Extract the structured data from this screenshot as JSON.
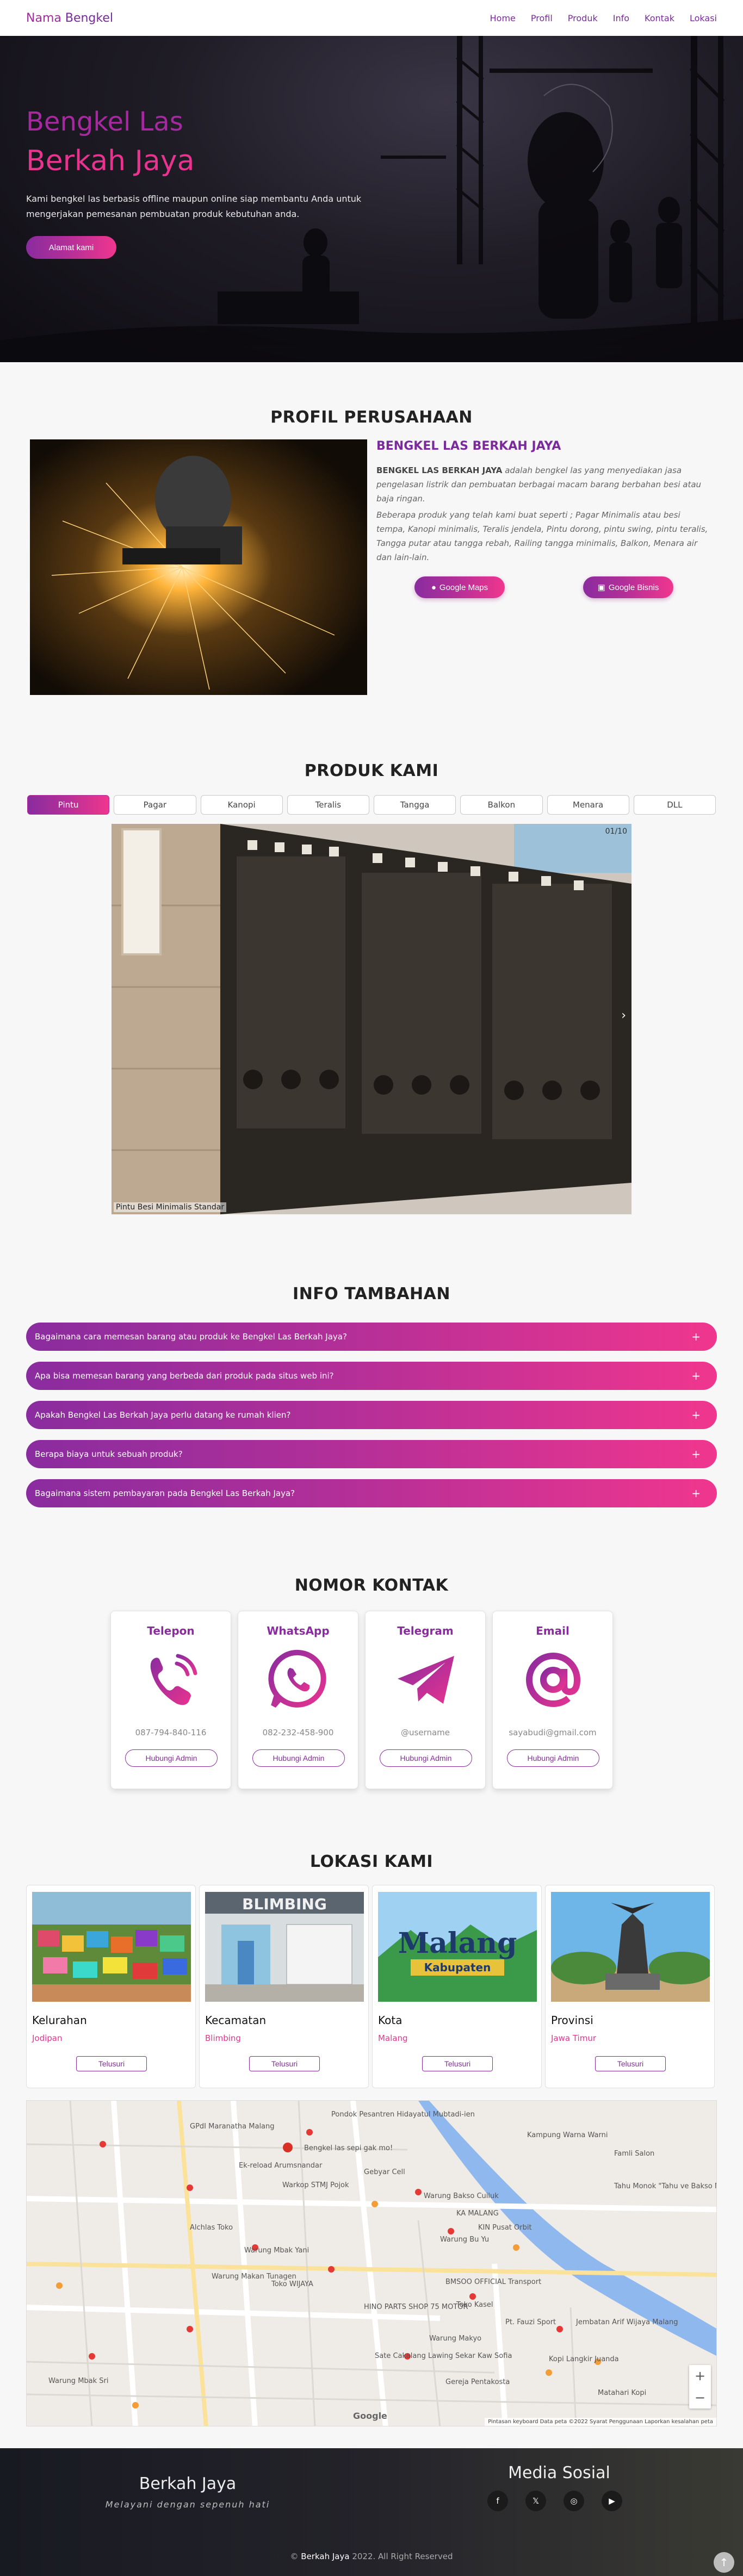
{
  "nav": {
    "brand_part1": "Nama",
    "brand_part2": "Bengkel",
    "links": [
      "Home",
      "Profil",
      "Produk",
      "Info",
      "Kontak",
      "Lokasi"
    ]
  },
  "hero": {
    "title_line1": "Bengkel Las",
    "title_line2": "Berkah Jaya",
    "description": "Kami bengkel las berbasis offline maupun online siap membantu Anda untuk mengerjakan pemesanan pembuatan produk kebutuhan anda.",
    "button_label": "Alamat kami"
  },
  "profil": {
    "section_title": "PROFIL PERUSAHAAN",
    "heading": "BENGKEL LAS BERKAH JAYA",
    "p1_bold": "BENGKEL LAS BERKAH JAYA",
    "p1_rest": " adalah bengkel las yang menyediakan jasa pengelasan listrik dan pembuatan berbagai macam barang berbahan besi atau baja ringan.",
    "p2": "Beberapa produk yang telah kami buat seperti ; Pagar Minimalis atau besi tempa, Kanopi minimalis, Teralis jendela, Pintu dorong, pintu swing, pintu teralis, Tangga putar atau tangga rebah, Railing tangga minimalis, Balkon, Menara air dan lain-lain.",
    "maps_button": "Google Maps",
    "bisnis_button": "Google Bisnis"
  },
  "produk": {
    "section_title": "PRODUK KAMI",
    "tabs": [
      "Pintu",
      "Pagar",
      "Kanopi",
      "Teralis",
      "Tangga",
      "Balkon",
      "Menara",
      "DLL"
    ],
    "active_tab": "Pintu",
    "counter": "01/10",
    "caption": "Pintu Besi Minimalis Standar",
    "next_icon": "›"
  },
  "info": {
    "section_title": "INFO TAMBAHAN",
    "faqs": [
      "Bagaimana cara memesan barang atau produk ke Bengkel Las Berkah Jaya?",
      "Apa bisa memesan barang yang berbeda dari produk pada situs web ini?",
      "Apakah Bengkel Las Berkah Jaya perlu datang ke rumah klien?",
      "Berapa biaya untuk sebuah produk?",
      "Bagaimana sistem pembayaran pada Bengkel Las Berkah Jaya?"
    ],
    "expand_icon": "+"
  },
  "kontak": {
    "section_title": "NOMOR KONTAK",
    "cards": [
      {
        "title": "Telepon",
        "value": "087-794-840-116",
        "button": "Hubungi Admin",
        "icon": "phone-icon"
      },
      {
        "title": "WhatsApp",
        "value": "082-232-458-900",
        "button": "Hubungi Admin",
        "icon": "whatsapp-icon"
      },
      {
        "title": "Telegram",
        "value": "@username",
        "button": "Hubungi Admin",
        "icon": "telegram-icon"
      },
      {
        "title": "Email",
        "value": "sayabudi@gmail.com",
        "button": "Hubungi Admin",
        "icon": "email-at-icon"
      }
    ]
  },
  "lokasi": {
    "section_title": "LOKASI KAMI",
    "cards": [
      {
        "title": "Kelurahan",
        "value": "Jodipan",
        "button": "Telusuri"
      },
      {
        "title": "Kecamatan",
        "value": "Blimbing",
        "button": "Telusuri"
      },
      {
        "title": "Kota",
        "value": "Malang",
        "button": "Telusuri"
      },
      {
        "title": "Provinsi",
        "value": "Jawa Timur",
        "button": "Telusuri"
      }
    ],
    "image_texts": {
      "kecamatan_sign": "BLIMBING",
      "kota_sign": "Malang",
      "kota_sub": "Kabupaten"
    },
    "map": {
      "labels": [
        "Pondok Pesantren Hidayatul Mubtadi-ien",
        "Bengkel las sepi gak mo!",
        "Kampung Warna Warni",
        "Famli Salon",
        "GPdI Maranatha Malang",
        "Ek-reload Arumsnandar",
        "Warkop STMJ Pojok",
        "Gebyar Cell",
        "Warung Bakso Cuiluk",
        "Tahu Monok \"Tahu ve Bakso Malang",
        "KA MALANG",
        "Warung Bu Yu",
        "Alchlas Toko",
        "Warung Mbak Yani",
        "Warung Makan Tunagen",
        "KIN Pusat Orbit",
        "Toko WIJAYA",
        "BMSOO OFFICIAL Transport",
        "HINO PARTS SHOP 75 MOTOR",
        "Toko Kasel",
        "Warung Makyo",
        "Pt. Fauzi Sport",
        "Jembatan Arif Wijaya Malang",
        "Kopi Langkir Juanda",
        "Sate Cakalang Lawing Sekar Kaw Sofia",
        "Gereja Pentakosta",
        "Warung Mbak Sri",
        "Matahari Kopi"
      ],
      "attribution": "Pintasan keyboard   Data peta ©2022   Syarat Penggunaan   Laporkan kesalahan peta",
      "google_logo": "Google",
      "zoom_in": "+",
      "zoom_out": "−"
    }
  },
  "footer": {
    "name": "Berkah Jaya",
    "tagline": "Melayani dengan sepenuh hati",
    "media_title": "Media Sosial",
    "social_icons": [
      "facebook-icon",
      "twitter-icon",
      "instagram-icon",
      "youtube-icon"
    ],
    "copyright_prefix": "© ",
    "copyright_name": "Berkah Jaya",
    "copyright_suffix": " 2022. All Right Reserved",
    "to_top": "↑"
  },
  "colors": {
    "purple": "#7b2a9c",
    "pink": "#e8338f",
    "hero_bg": "#1f1c26",
    "footer_bg": "#24232a"
  }
}
